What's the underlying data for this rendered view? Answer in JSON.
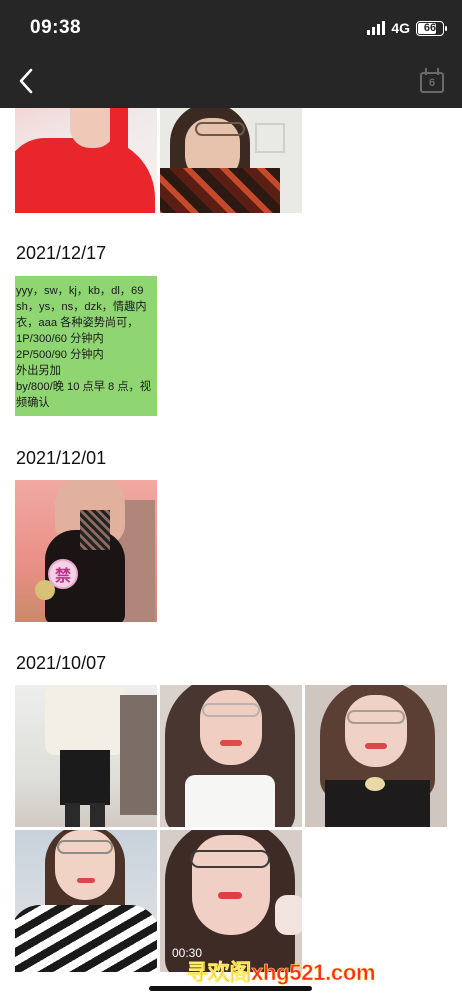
{
  "status_bar": {
    "time": "09:38",
    "network": "4G",
    "battery": "66"
  },
  "nav": {
    "back_icon": "chevron-left-icon",
    "calendar_icon": "calendar-icon",
    "calendar_day": "6"
  },
  "sections": [
    {
      "date": "",
      "items": [
        "photo-red-top",
        "photo-floral-dress"
      ]
    },
    {
      "date": "2021/12/17",
      "items": [
        "text-post"
      ]
    },
    {
      "date": "2021/12/01",
      "items": [
        "photo-black-bodystocking"
      ]
    },
    {
      "date": "2021/10/07",
      "items": [
        "photo-white-blouse",
        "photo-long-hair-white-shirt",
        "photo-glasses-smile",
        "photo-striped-top",
        "video-close-up"
      ]
    }
  ],
  "text_post": {
    "lines": [
      "yyy，sw，kj，kb，dl，69",
      "sh，ys，ns，dzk，情趣内",
      "衣，aaa 各种姿势尚可，",
      "1P/300/60 分钟内",
      "2P/500/90 分钟内",
      "外出另加",
      "by/800/晚 10 点早 8 点，视",
      "频确认"
    ],
    "bg_color": "#8fd673"
  },
  "stamp_text": "禁",
  "video_duration": "00:30",
  "watermark": "寻欢阁xhg521.com",
  "colors": {
    "header_bg": "#262626",
    "watermark": "#ff2a2a"
  }
}
